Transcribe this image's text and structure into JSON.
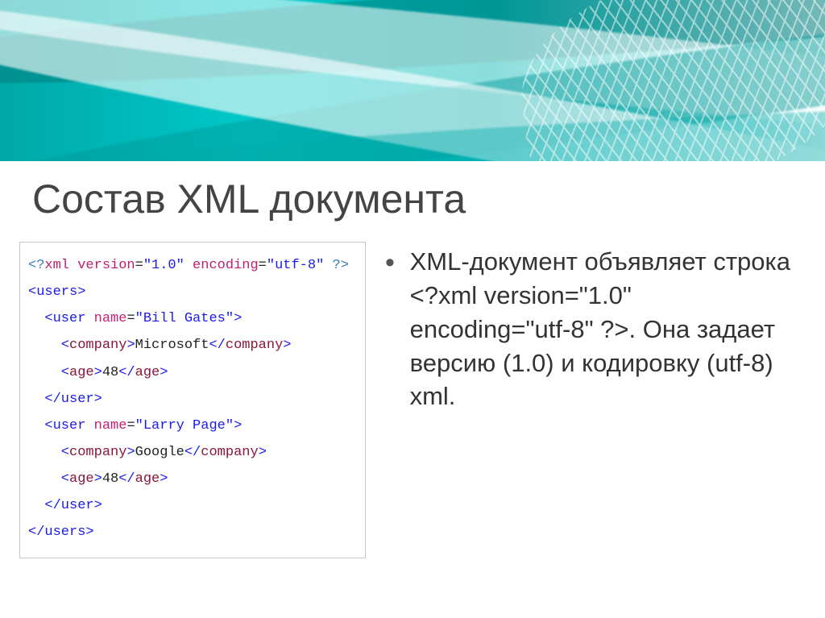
{
  "title": "Состав XML документа",
  "code": {
    "line1_a": "<?",
    "line1_b": "xml version",
    "line1_c": "=",
    "line1_d": "\"1.0\"",
    "line1_e": " encoding",
    "line1_f": "=",
    "line1_g": "\"utf-8\"",
    "line1_h": " ?>",
    "l2_open_users": "<users>",
    "l3_a": "  <user ",
    "l3_b": "name",
    "l3_c": "=",
    "l3_d": "\"Bill Gates\"",
    "l3_e": ">",
    "l4_a": "    <company>",
    "l4_b": "Microsoft",
    "l4_c": "</company>",
    "l5_a": "    <age>",
    "l5_b": "48",
    "l5_c": "</age>",
    "l6_close_user": "  </user>",
    "l7_a": "  <user ",
    "l7_b": "name",
    "l7_c": "=",
    "l7_d": "\"Larry Page\"",
    "l7_e": ">",
    "l8_a": "    <company>",
    "l8_b": "Google",
    "l8_c": "</company>",
    "l9_a": "    <age>",
    "l9_b": "48",
    "l9_c": "</age>",
    "l10_close_user": "  </user>",
    "l11_close_users": "</users>"
  },
  "bullet": {
    "text": "XML-документ объявляет строка <?xml version=\"1.0\" encoding=\"utf-8\" ?>. Она задает версию (1.0) и кодировку (utf-8) xml."
  }
}
